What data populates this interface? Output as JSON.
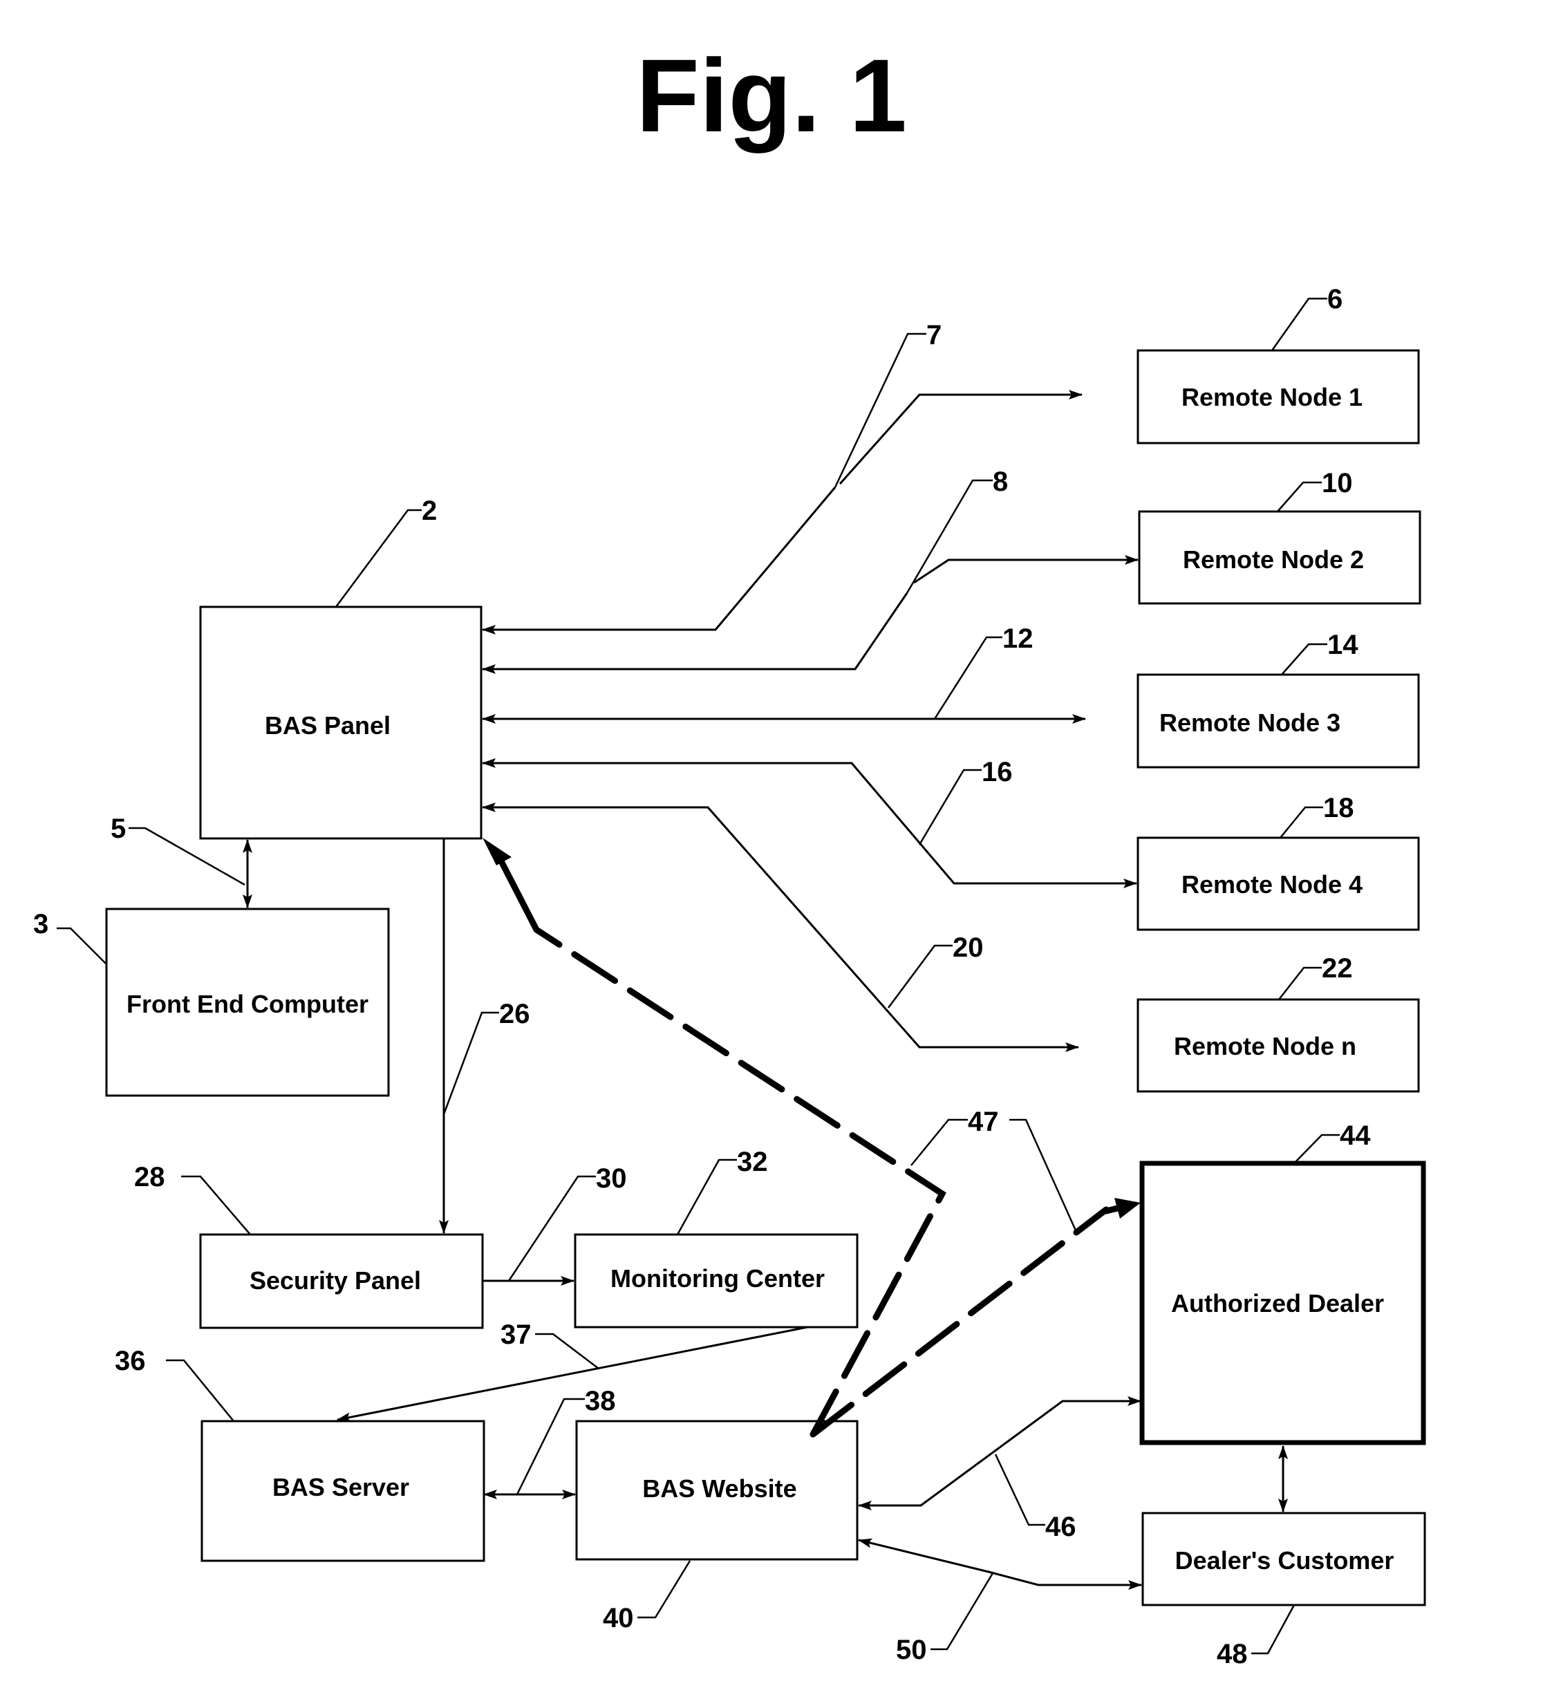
{
  "figure": {
    "title": "Fig. 1"
  },
  "boxes": {
    "bas_panel": {
      "label": "BAS Panel",
      "ref": "2"
    },
    "front_end_computer": {
      "label": "Front End Computer",
      "ref": "3"
    },
    "remote_node_1": {
      "label": "Remote Node 1",
      "ref": "6"
    },
    "remote_node_2": {
      "label": "Remote Node 2",
      "ref": "10"
    },
    "remote_node_3": {
      "label": "Remote Node 3",
      "ref": "14"
    },
    "remote_node_4": {
      "label": "Remote Node 4",
      "ref": "18"
    },
    "remote_node_n": {
      "label": "Remote Node n",
      "ref": "22"
    },
    "security_panel": {
      "label": "Security Panel",
      "ref": "28"
    },
    "monitoring_center": {
      "label": "Monitoring Center",
      "ref": "32"
    },
    "bas_server": {
      "label": "BAS Server",
      "ref": "36"
    },
    "bas_website": {
      "label": "BAS Website",
      "ref": "40"
    },
    "authorized_dealer": {
      "label": "Authorized Dealer",
      "ref": "44"
    },
    "dealers_customer": {
      "label": "Dealer's Customer",
      "ref": "48"
    }
  },
  "links": {
    "panel_frontend": {
      "ref": "5",
      "from": "BAS Panel",
      "to": "Front End Computer",
      "direction": "bidirectional"
    },
    "panel_node1": {
      "ref": "7",
      "from": "BAS Panel",
      "to": "Remote Node 1",
      "direction": "bidirectional"
    },
    "panel_node2": {
      "ref": "8",
      "from": "BAS Panel",
      "to": "Remote Node 2",
      "direction": "bidirectional"
    },
    "panel_node3": {
      "ref": "12",
      "from": "BAS Panel",
      "to": "Remote Node 3",
      "direction": "bidirectional"
    },
    "panel_node4": {
      "ref": "16",
      "from": "BAS Panel",
      "to": "Remote Node 4",
      "direction": "bidirectional"
    },
    "panel_noden": {
      "ref": "20",
      "from": "BAS Panel",
      "to": "Remote Node n",
      "direction": "bidirectional"
    },
    "panel_security": {
      "ref": "26",
      "from": "BAS Panel",
      "to": "Security Panel",
      "direction": "forward"
    },
    "security_monitoring": {
      "ref": "30",
      "from": "Security Panel",
      "to": "Monitoring Center",
      "direction": "forward"
    },
    "monitoring_server": {
      "ref": "37",
      "from": "Monitoring Center",
      "to": "BAS Server",
      "direction": "forward"
    },
    "server_website": {
      "ref": "38",
      "from": "BAS Server",
      "to": "BAS Website",
      "direction": "bidirectional"
    },
    "website_panel_dealer": {
      "ref": "47",
      "from": "BAS Website",
      "to": "BAS Panel / Authorized Dealer",
      "style": "dashed"
    },
    "dealer_website": {
      "ref": "46",
      "from": "Authorized Dealer",
      "to": "BAS Website",
      "direction": "bidirectional"
    },
    "customer_website": {
      "ref": "50",
      "from": "Dealer's Customer",
      "to": "BAS Website",
      "direction": "bidirectional"
    },
    "dealer_customer": {
      "from": "Authorized Dealer",
      "to": "Dealer's Customer",
      "direction": "bidirectional"
    }
  }
}
